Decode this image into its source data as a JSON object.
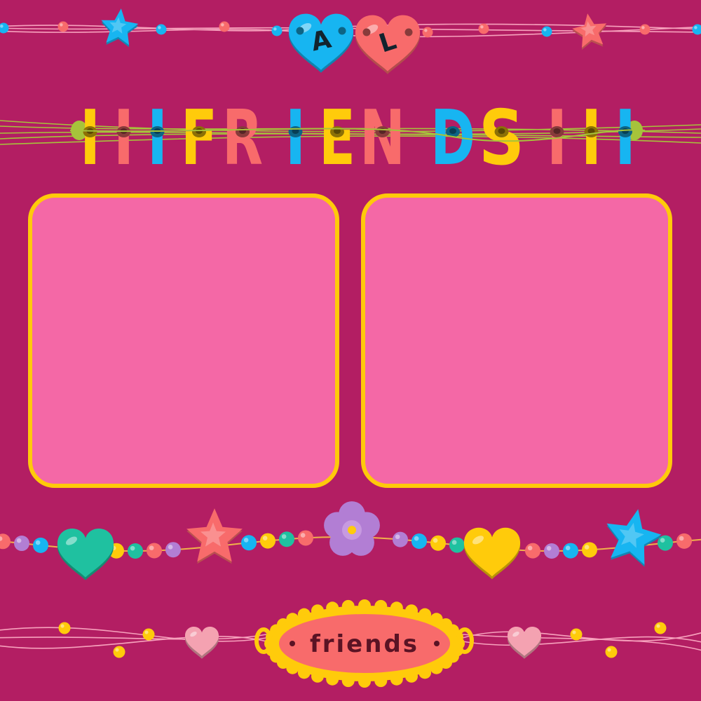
{
  "palette": {
    "background": "#b31e63",
    "slot_fill": "#f468a6",
    "slot_border": "#ffca0a",
    "yellow": "#ffcb0b",
    "coral": "#f86b6b",
    "blue": "#17b5f1",
    "teal": "#1fc1a0",
    "purple": "#b27ed4",
    "light_pink": "#f4a2b1",
    "string": "#f7a2bd",
    "green_string": "#a6c33b"
  },
  "top_bracelet": {
    "heart_beads": [
      {
        "letter": "A",
        "color": "blue",
        "icon": "heart-icon"
      },
      {
        "letter": "L",
        "color": "coral",
        "icon": "heart-icon"
      }
    ],
    "stars": [
      "blue",
      "coral"
    ]
  },
  "title": {
    "letters": [
      {
        "char": "I",
        "color": "yellow"
      },
      {
        "char": "I",
        "color": "coral"
      },
      {
        "char": "I",
        "color": "blue"
      },
      {
        "char": "F",
        "color": "yellow"
      },
      {
        "char": "R",
        "color": "coral"
      },
      {
        "char": "I",
        "color": "blue"
      },
      {
        "char": "E",
        "color": "yellow"
      },
      {
        "char": "N",
        "color": "coral"
      },
      {
        "char": "D",
        "color": "blue"
      },
      {
        "char": "S",
        "color": "yellow"
      },
      {
        "char": "I",
        "color": "coral"
      },
      {
        "char": "I",
        "color": "yellow"
      },
      {
        "char": "I",
        "color": "blue"
      }
    ]
  },
  "photo_slots": [
    {
      "name": "photo-slot-left"
    },
    {
      "name": "photo-slot-right"
    }
  ],
  "charm_bracelet": {
    "charms": [
      {
        "kind": "heart",
        "color": "teal"
      },
      {
        "kind": "star",
        "color": "coral"
      },
      {
        "kind": "flower",
        "color": "purple"
      },
      {
        "kind": "heart",
        "color": "yellow"
      },
      {
        "kind": "star",
        "color": "blue"
      }
    ],
    "bead_cycle": [
      "coral",
      "purple",
      "blue",
      "yellow",
      "teal"
    ]
  },
  "name_tag": {
    "text": "friends",
    "icon": "oval-tag-icon"
  }
}
